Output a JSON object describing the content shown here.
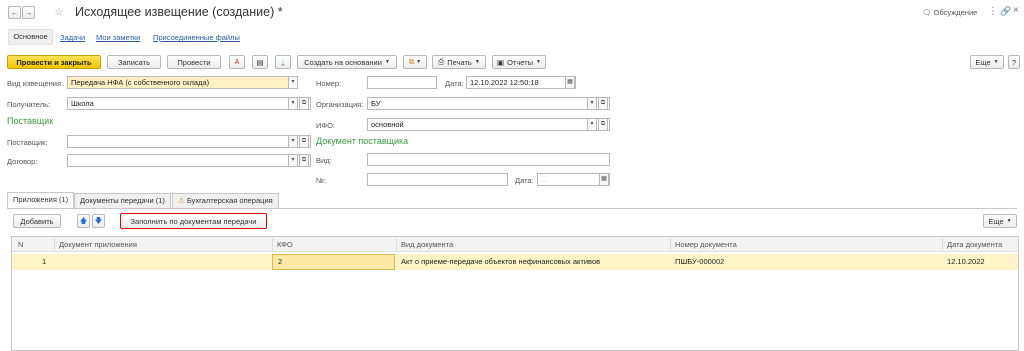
{
  "window": {
    "title": "Исходящее извещение (создание) *",
    "discussion_label": "Обсуждение"
  },
  "nav_tabs": [
    "Основное",
    "Задачи",
    "Мои заметки",
    "Присоединенные файлы"
  ],
  "toolbar": {
    "post_close": "Провести и закрыть",
    "save": "Записать",
    "post": "Провести",
    "create_based": "Создать на основании",
    "print": "Печать",
    "reports": "Отчеты",
    "more": "Еще"
  },
  "form": {
    "notice_type_label": "Вид извещения:",
    "notice_type_value": "Передача НФА (с собственного склада)",
    "number_label": "Номер:",
    "number_value": "",
    "date_label": "Дата:",
    "date_value": "12.10.2022 12:50:18",
    "recipient_label": "Получатель:",
    "recipient_value": "Школа",
    "org_label": "Организация:",
    "org_value": "БУ",
    "supplier_section": "Поставщик",
    "ifo_label": "ИФО:",
    "ifo_value": "основной",
    "supplier_label": "Поставщик:",
    "supplier_value": "",
    "supplier_doc_section": "Документ поставщика",
    "contract_label": "Договор:",
    "contract_value": "",
    "kind_label": "Вид:",
    "kind_value": "",
    "num_label": "№:",
    "num_value": "",
    "doc_date_label": "Дата:",
    "doc_date_value": ". .   "
  },
  "sub_tabs": [
    "Приложения (1)",
    "Документы передачи (1)",
    "Бухгалтерская операция"
  ],
  "table_toolbar": {
    "add": "Добавить",
    "fill": "Заполнить по документам передачи",
    "more": "Еще"
  },
  "table": {
    "headers": [
      "N",
      "Документ приложения",
      "КФО",
      "Вид документа",
      "Номер документа",
      "Дата документа"
    ],
    "rows": [
      [
        "1",
        "",
        "2",
        "Акт о приеме-передаче объектов нефинансовых активов",
        "ПШБУ-000002",
        "12.10.2022"
      ]
    ]
  },
  "colors": {
    "accent_yellow": "#f3c500",
    "section_green": "#3a9a45",
    "highlight_red": "#e00000",
    "selected_row": "#fff4c8"
  }
}
